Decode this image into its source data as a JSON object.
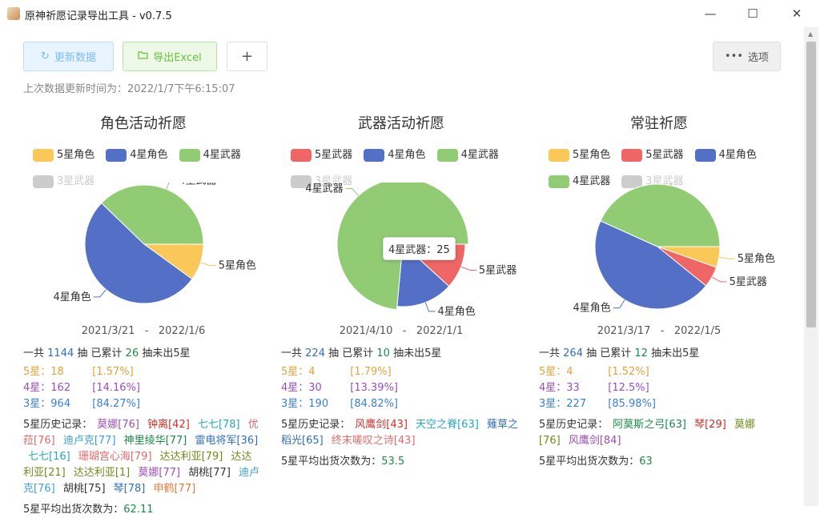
{
  "window": {
    "title": "原神祈愿记录导出工具 - v0.7.5",
    "min": "—",
    "max": "☐",
    "close": "✕"
  },
  "toolbar": {
    "update_label": "更新数据",
    "update_icon": "refresh-icon",
    "export_label": "导出Excel",
    "export_icon": "folder-icon",
    "add_label": "+",
    "options_label": "选项",
    "options_icon": "more-icon"
  },
  "update_time": "上次数据更新时间为：2022/1/7下午6:15:07",
  "colors": {
    "five_char": "#fac858",
    "four_char": "#5470c6",
    "four_weapon": "#91cc75",
    "five_weapon": "#ee6666",
    "three": "#cccccc"
  },
  "pools": [
    {
      "title": "角色活动祈愿",
      "legend": [
        {
          "label": "5星角色",
          "color": "#fac858",
          "off": false
        },
        {
          "label": "4星角色",
          "color": "#5470c6",
          "off": false
        },
        {
          "label": "4星武器",
          "color": "#91cc75",
          "off": false
        },
        {
          "label": "3星武器",
          "color": "#cccccc",
          "off": true
        }
      ],
      "date_range": "2021/3/21   -   2022/1/6",
      "total": {
        "prefix": "一共",
        "count": "1144",
        "mid": "抽 已累计",
        "pity": "26",
        "suffix": "抽未出5星"
      },
      "stars": [
        {
          "label": "5星：",
          "count": "18",
          "pct": "[1.57%]",
          "color": "#e6a23c"
        },
        {
          "label": "4星：",
          "count": "162",
          "pct": "[14.16%]",
          "color": "#9a4fb8"
        },
        {
          "label": "3星：",
          "count": "964",
          "pct": "[84.27%]",
          "color": "#3a7fd0"
        }
      ],
      "history_label": "5星历史记录：",
      "history": [
        {
          "text": "莫娜[76]",
          "color": "#9a4fb8"
        },
        {
          "text": "钟离[42]",
          "color": "#d0302a"
        },
        {
          "text": "七七[78]",
          "color": "#26a6c4"
        },
        {
          "text": "优菈[76]",
          "color": "#e46a6a"
        },
        {
          "text": "迪卢克[77]",
          "color": "#3aa0d8"
        },
        {
          "text": "神里绫华[77]",
          "color": "#1b8a4a"
        },
        {
          "text": "雷电将军[36]",
          "color": "#2f6fbf"
        },
        {
          "text": "七七[16]",
          "color": "#26a6c4"
        },
        {
          "text": "珊瑚宫心海[79]",
          "color": "#e46a6a"
        },
        {
          "text": "达达利亚[79]",
          "color": "#6e8c1a"
        },
        {
          "text": "达达利亚[21]",
          "color": "#6e8c1a"
        },
        {
          "text": "达达利亚[1]",
          "color": "#6e8c1a"
        },
        {
          "text": "莫娜[77]",
          "color": "#9a4fb8"
        },
        {
          "text": "胡桃[77]",
          "color": "#333333"
        },
        {
          "text": "迪卢克[76]",
          "color": "#3aa0d8"
        },
        {
          "text": "胡桃[75]",
          "color": "#333333"
        },
        {
          "text": "琴[78]",
          "color": "#2f6fbf"
        },
        {
          "text": "申鹤[77]",
          "color": "#e07a3c"
        }
      ],
      "avg_label": "5星平均出货次数为：",
      "avg_value": "62.11",
      "chart_data": {
        "type": "pie",
        "slices": [
          {
            "label": "5星角色",
            "value": 18,
            "color": "#fac858"
          },
          {
            "label": "4星角色",
            "value": 94,
            "color": "#5470c6"
          },
          {
            "label": "4星武器",
            "value": 68,
            "color": "#91cc75"
          }
        ]
      }
    },
    {
      "title": "武器活动祈愿",
      "legend": [
        {
          "label": "5星武器",
          "color": "#ee6666",
          "off": false
        },
        {
          "label": "4星角色",
          "color": "#5470c6",
          "off": false
        },
        {
          "label": "4星武器",
          "color": "#91cc75",
          "off": false
        },
        {
          "label": "3星武器",
          "color": "#cccccc",
          "off": true
        }
      ],
      "date_range": "2021/4/10   -   2022/1/1",
      "total": {
        "prefix": "一共",
        "count": "224",
        "mid": "抽 已累计",
        "pity": "10",
        "suffix": "抽未出5星"
      },
      "stars": [
        {
          "label": "5星：",
          "count": "4",
          "pct": "[1.79%]",
          "color": "#e6a23c"
        },
        {
          "label": "4星：",
          "count": "30",
          "pct": "[13.39%]",
          "color": "#9a4fb8"
        },
        {
          "label": "3星：",
          "count": "190",
          "pct": "[84.82%]",
          "color": "#3a7fd0"
        }
      ],
      "history_label": "5星历史记录：",
      "history": [
        {
          "text": "风鹰剑[43]",
          "color": "#d0302a"
        },
        {
          "text": "天空之脊[63]",
          "color": "#26a6c4"
        },
        {
          "text": "薙草之稻光[65]",
          "color": "#2f6fbf"
        },
        {
          "text": "终末嗟叹之诗[43]",
          "color": "#e46a6a"
        }
      ],
      "avg_label": "5星平均出货次数为：",
      "avg_value": "53.5",
      "tooltip": "4星武器：25",
      "chart_data": {
        "type": "pie",
        "slices": [
          {
            "label": "5星武器",
            "value": 4,
            "color": "#ee6666"
          },
          {
            "label": "4星角色",
            "value": 5,
            "color": "#5470c6"
          },
          {
            "label": "4星武器",
            "value": 25,
            "color": "#91cc75"
          }
        ]
      }
    },
    {
      "title": "常驻祈愿",
      "legend": [
        {
          "label": "5星角色",
          "color": "#fac858",
          "off": false
        },
        {
          "label": "5星武器",
          "color": "#ee6666",
          "off": false
        },
        {
          "label": "4星角色",
          "color": "#5470c6",
          "off": false
        },
        {
          "label": "4星武器",
          "color": "#91cc75",
          "off": false
        },
        {
          "label": "3星武器",
          "color": "#cccccc",
          "off": true
        }
      ],
      "date_range": "2021/3/17   -   2022/1/5",
      "total": {
        "prefix": "一共",
        "count": "264",
        "mid": "抽 已累计",
        "pity": "12",
        "suffix": "抽未出5星"
      },
      "stars": [
        {
          "label": "5星：",
          "count": "4",
          "pct": "[1.52%]",
          "color": "#e6a23c"
        },
        {
          "label": "4星：",
          "count": "33",
          "pct": "[12.5%]",
          "color": "#9a4fb8"
        },
        {
          "label": "3星：",
          "count": "227",
          "pct": "[85.98%]",
          "color": "#3a7fd0"
        }
      ],
      "history_label": "5星历史记录：",
      "history": [
        {
          "text": "阿莫斯之弓[63]",
          "color": "#1b8a4a"
        },
        {
          "text": "琴[29]",
          "color": "#d0302a"
        },
        {
          "text": "莫娜[76]",
          "color": "#6e8c1a"
        },
        {
          "text": "风鹰剑[84]",
          "color": "#9a4fb8"
        }
      ],
      "avg_label": "5星平均出货次数为：",
      "avg_value": "63",
      "chart_data": {
        "type": "pie",
        "slices": [
          {
            "label": "5星角色",
            "value": 2,
            "color": "#fac858"
          },
          {
            "label": "5星武器",
            "value": 2,
            "color": "#ee6666"
          },
          {
            "label": "4星角色",
            "value": 17,
            "color": "#5470c6"
          },
          {
            "label": "4星武器",
            "value": 16,
            "color": "#91cc75"
          }
        ]
      }
    }
  ]
}
